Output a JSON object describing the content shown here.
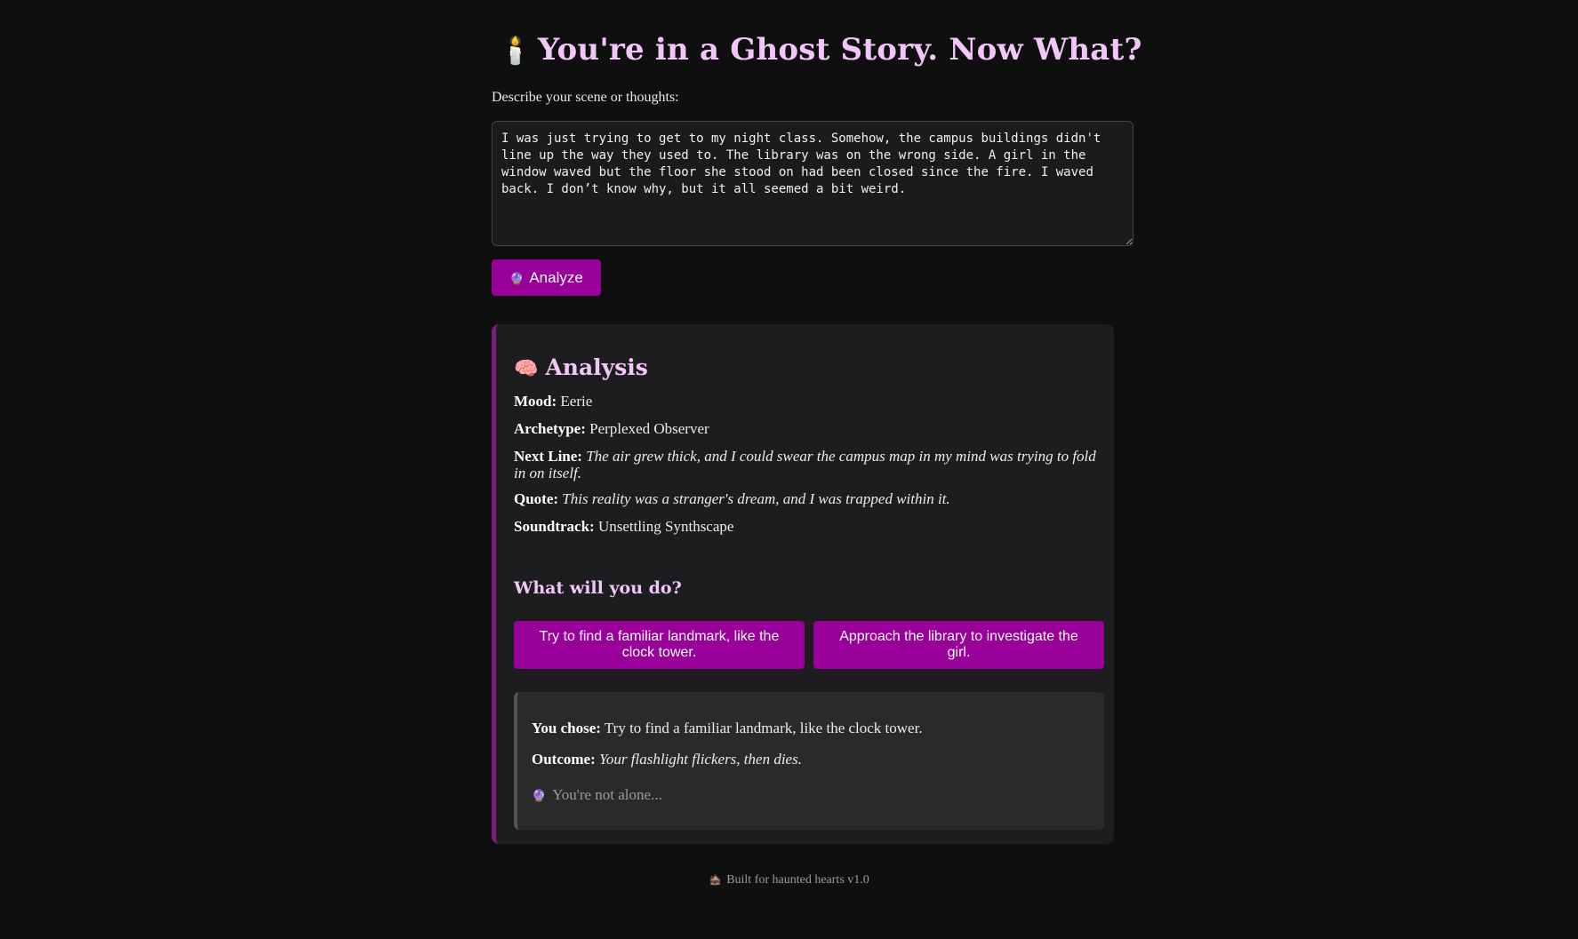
{
  "header": {
    "icon": "candle-icon",
    "icon_glyph": "🕯️",
    "title": "You're in a Ghost Story. Now What?"
  },
  "input": {
    "label": "Describe your scene or thoughts:",
    "value": "I was just trying to get to my night class. Somehow, the campus buildings didn't line up the way they used to. The library was on the wrong side. A girl in the window waved but the floor she stood on had been closed since the fire. I waved back. I don’t know why, but it all seemed a bit weird."
  },
  "analyze_button": {
    "icon": "crystal-ball-icon",
    "icon_glyph": "🔮",
    "label": "Analyze"
  },
  "analysis": {
    "icon": "brain-icon",
    "icon_glyph": "🧠",
    "heading": "Analysis",
    "mood_label": "Mood:",
    "mood": "Eerie",
    "archetype_label": "Archetype:",
    "archetype": "Perplexed Observer",
    "next_line_label": "Next Line:",
    "next_line": "The air grew thick, and I could swear the campus map in my mind was trying to fold in on itself.",
    "quote_label": "Quote:",
    "quote": "This reality was a stranger's dream, and I was trapped within it.",
    "soundtrack_label": "Soundtrack:",
    "soundtrack": "Unsettling Synthscape",
    "prompt": "What will you do?",
    "choices": [
      "Try to find a familiar landmark, like the clock tower.",
      "Approach the library to investigate the girl."
    ]
  },
  "result": {
    "chose_label": "You chose:",
    "chose": "Try to find a familiar landmark, like the clock tower.",
    "outcome_label": "Outcome:",
    "outcome": "Your flashlight flickers, then dies.",
    "alone_icon": "crystal-ball-icon",
    "alone_glyph": "🔮",
    "alone_text": "You're not alone..."
  },
  "footer": {
    "icon": "ghost-house-icon",
    "icon_glyph": "🏚️",
    "text": "Built for haunted hearts v1.0"
  },
  "colors": {
    "background": "#0f0f0f",
    "accent": "#990099",
    "heading_pink": "#f2c6f8",
    "panel": "#1d1d1f",
    "panel_border": "#7a1f7a"
  }
}
